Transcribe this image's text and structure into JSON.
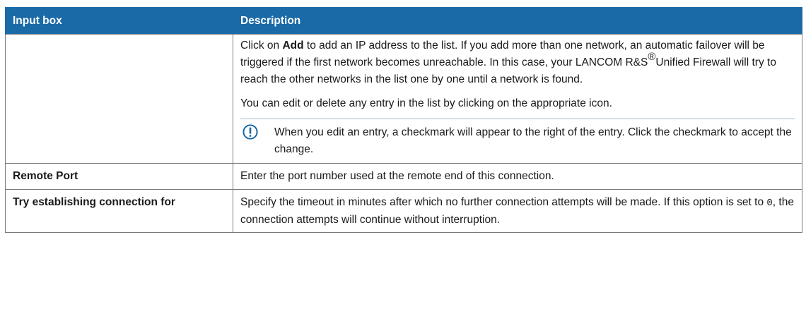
{
  "table": {
    "headers": [
      "Input box",
      "Description"
    ],
    "row_ip": {
      "label": "",
      "p1_before": "Click on ",
      "p1_bold": "Add",
      "p1_after": " to add an IP address to the list. If you add more than one network, an automatic failover will be triggered if the first network becomes unreachable. In this case, your LANCOM R&S",
      "p1_reg": "®",
      "p1_end": "Unified Firewall will try to reach the other networks in the list one by one until a network is found.",
      "p2": "You can edit or delete any entry in the list by clicking on the appropriate icon.",
      "note": "When you edit an entry, a checkmark will appear to the right of the entry. Click the checkmark to accept the change.",
      "note_icon": "exclamation-circle-icon"
    },
    "row_port": {
      "label": "Remote Port",
      "text": "Enter the port number used at the remote end of this connection."
    },
    "row_try": {
      "label": "Try establishing connection for",
      "text_before": "Specify the timeout in minutes after which no further connection attempts will be made. If this option is set to ",
      "code": "0",
      "text_after": ", the connection attempts will continue without interruption."
    }
  },
  "colors": {
    "header_bg": "#1a6aa8",
    "header_text": "#ffffff",
    "note_icon": "#1a6aa8"
  }
}
